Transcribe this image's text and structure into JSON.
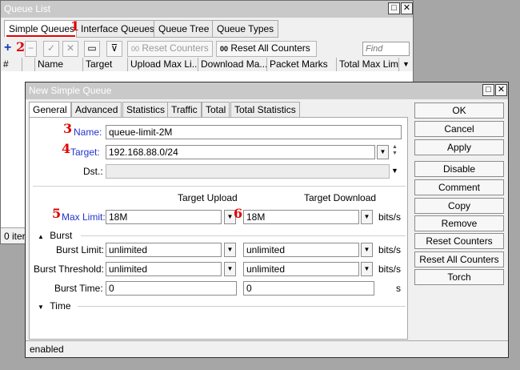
{
  "queue_list": {
    "title": "Queue List",
    "window_btn_restore": "□",
    "window_btn_close": "✕",
    "tabs": [
      "Simple Queues",
      "Interface Queues",
      "Queue Tree",
      "Queue Types"
    ],
    "toolbar": {
      "add": "+",
      "remove": "−",
      "enable": "✓",
      "disable": "✕",
      "comment": "▭",
      "filter": "⊽",
      "reset_counters": "Reset Counters",
      "reset_all_counters": "Reset All Counters",
      "find_placeholder": "Find",
      "oo": "00"
    },
    "columns": [
      "#",
      "",
      "Name",
      "Target",
      "Upload Max Li...",
      "Download Ma...",
      "Packet Marks",
      "Total Max Limi"
    ],
    "status": "0 iter"
  },
  "dialog": {
    "title": "New Simple Queue",
    "window_btn_restore": "□",
    "window_btn_close": "✕",
    "tabs": [
      "General",
      "Advanced",
      "Statistics",
      "Traffic",
      "Total",
      "Total Statistics"
    ],
    "fields": {
      "name_label": "Name:",
      "name_value": "queue-limit-2M",
      "target_label": "Target:",
      "target_value": "192.168.88.0/24",
      "dst_label": "Dst.:",
      "dst_value": "",
      "target_upload_header": "Target Upload",
      "target_download_header": "Target Download",
      "max_limit_label": "Max Limit:",
      "max_limit_upload": "18M",
      "max_limit_download": "18M",
      "burst_section": "Burst",
      "burst_limit_label": "Burst Limit:",
      "burst_limit_upload": "unlimited",
      "burst_limit_download": "unlimited",
      "burst_threshold_label": "Burst Threshold:",
      "burst_threshold_upload": "unlimited",
      "burst_threshold_download": "unlimited",
      "burst_time_label": "Burst Time:",
      "burst_time_upload": "0",
      "burst_time_download": "0",
      "time_section": "Time",
      "unit_bits": "bits/s",
      "unit_s": "s"
    },
    "buttons": [
      "OK",
      "Cancel",
      "Apply",
      "Disable",
      "Comment",
      "Copy",
      "Remove",
      "Reset Counters",
      "Reset All Counters",
      "Torch"
    ],
    "status": "enabled"
  },
  "markers": [
    "1",
    "2",
    "3",
    "4",
    "5",
    "6"
  ],
  "colors": {
    "marker_red": "#e00000",
    "label_blue": "#2233cc"
  }
}
